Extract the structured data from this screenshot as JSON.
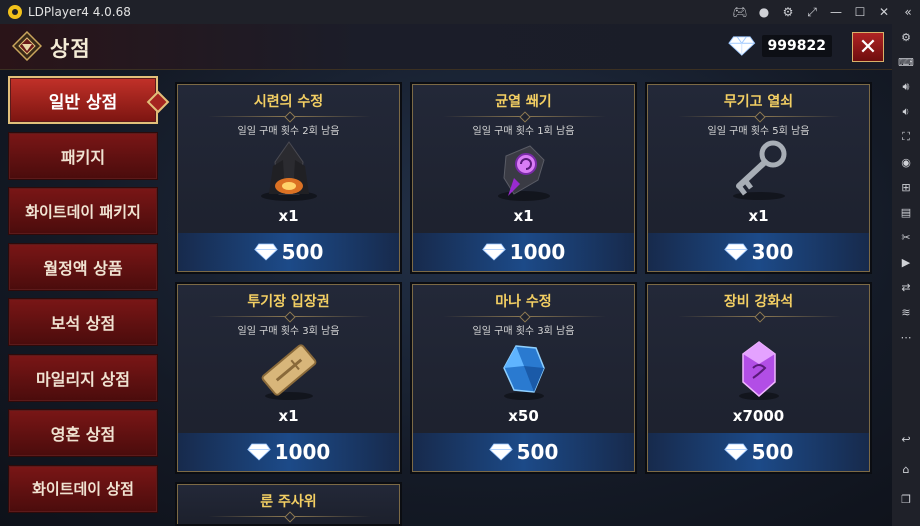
{
  "window": {
    "title": "LDPlayer4 4.0.68",
    "controls": [
      "gamepad-icon",
      "account-icon",
      "settings-icon",
      "fullscreen-icon",
      "minimize-icon",
      "maximize-icon",
      "close-icon",
      "collapse-icon"
    ]
  },
  "toolbar": {
    "icons": [
      "keyboard-icon",
      "volume-up-icon",
      "volume-down-icon",
      "screenshot-icon",
      "record-icon",
      "add-apk-icon",
      "apk-icon",
      "scissors-icon",
      "video-icon",
      "sync-icon",
      "shake-icon",
      "more-icon",
      "back-icon",
      "home-icon",
      "recent-apps-icon"
    ]
  },
  "shop": {
    "title": "상점",
    "currency": "999822",
    "close_label": "✕"
  },
  "tabs": [
    {
      "label": "일반 상점",
      "active": true
    },
    {
      "label": "패키지",
      "active": false
    },
    {
      "label": "화이트데이 패키지",
      "active": false
    },
    {
      "label": "월정액 상품",
      "active": false
    },
    {
      "label": "보석 상점",
      "active": false
    },
    {
      "label": "마일리지 상점",
      "active": false
    },
    {
      "label": "영혼 상점",
      "active": false
    },
    {
      "label": "화이트데이 상점",
      "active": false
    }
  ],
  "products": [
    {
      "name": "시련의 수정",
      "limit": "일일 구매 횟수 2회 남음",
      "qty": "x1",
      "price": "500",
      "icon": "trial-crystal-icon",
      "color": "#e0692a"
    },
    {
      "name": "균열 쐐기",
      "limit": "일일 구매 횟수 1회 남음",
      "qty": "x1",
      "price": "1000",
      "icon": "rift-wedge-icon",
      "color": "#b24ad8"
    },
    {
      "name": "무기고 열쇠",
      "limit": "일일 구매 횟수 5회 남음",
      "qty": "x1",
      "price": "300",
      "icon": "armory-key-icon",
      "color": "#9aa0a8"
    },
    {
      "name": "투기장 입장권",
      "limit": "일일 구매 횟수 3회 남음",
      "qty": "x1",
      "price": "1000",
      "icon": "arena-ticket-icon",
      "color": "#c8a468"
    },
    {
      "name": "마나 수정",
      "limit": "일일 구매 횟수 3회 남음",
      "qty": "x50",
      "price": "500",
      "icon": "mana-crystal-icon",
      "color": "#3a8fe0"
    },
    {
      "name": "장비 강화석",
      "limit": "",
      "qty": "x7000",
      "price": "500",
      "icon": "enhance-stone-icon",
      "color": "#c159e8"
    },
    {
      "name": "룬 주사위",
      "limit": "",
      "qty": "",
      "price": "",
      "icon": "rune-dice-icon",
      "color": "#c8a468"
    }
  ]
}
